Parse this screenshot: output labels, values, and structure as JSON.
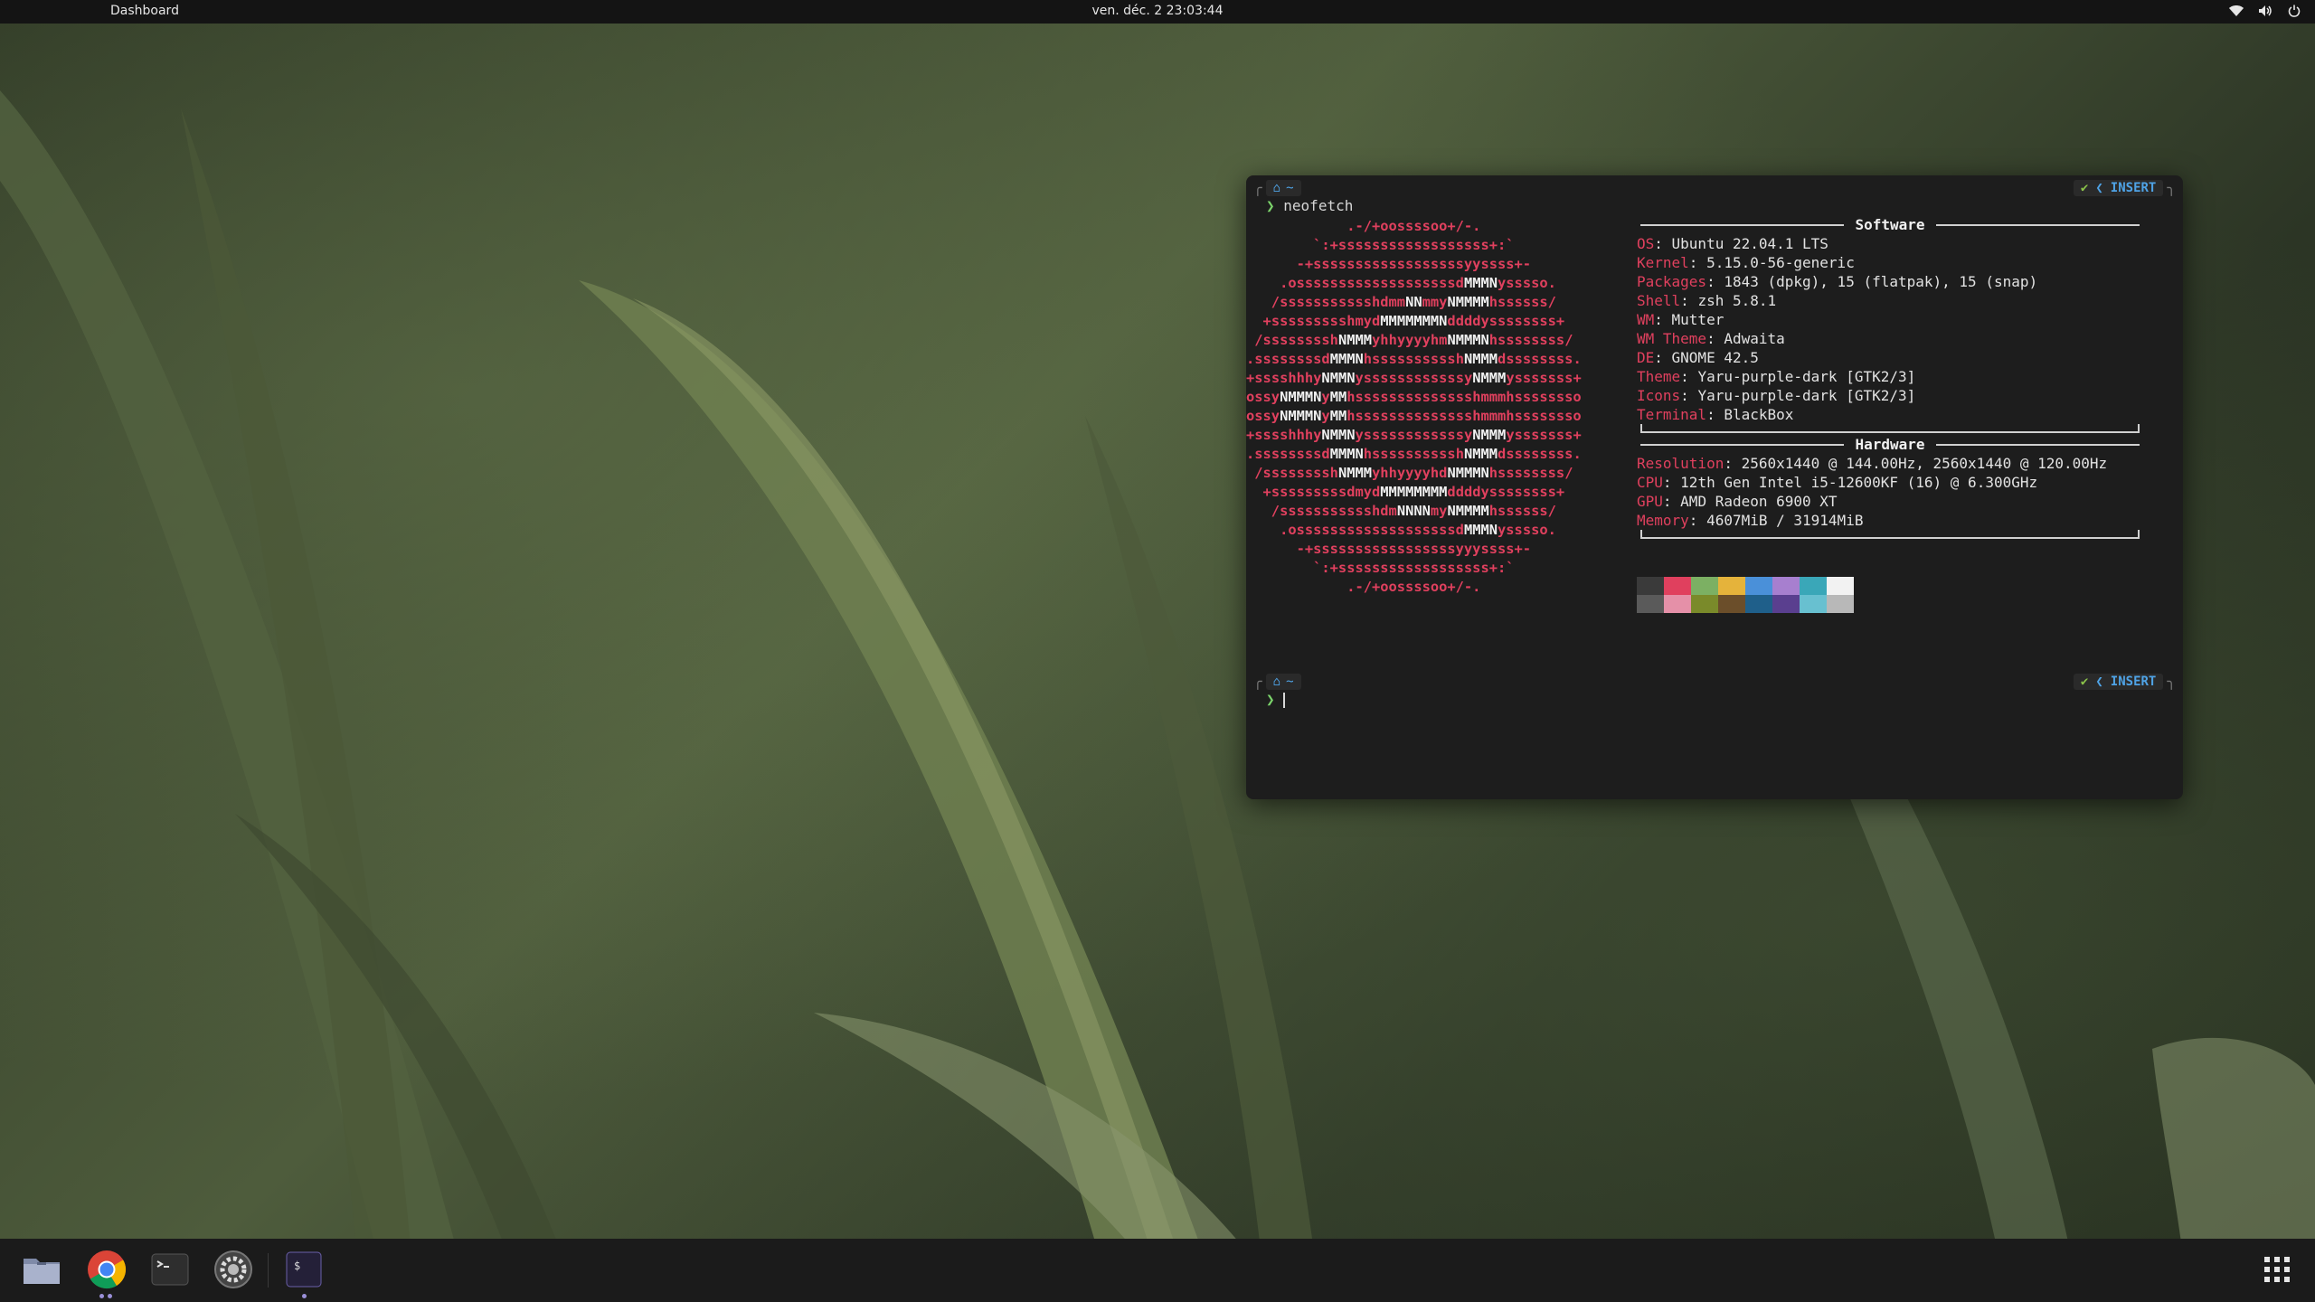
{
  "topbar": {
    "activities": "Dashboard",
    "clock": "ven. déc. 2  23:03:44"
  },
  "terminal": {
    "prompt_home_icon": "home-icon",
    "prompt_dir": "~",
    "mode": "INSERT",
    "command": "neofetch",
    "ascii_lines": [
      "            .-/+oossssoo+/-.",
      "        `:+ssssssssssssssssss+:`",
      "      -+ssssssssssssssssssyyssss+-",
      "    .osssssssssssssssssssdMMMNysssso.",
      "   /ssssssssssshdmmNNmmyNMMMMhssssss/",
      "  +ssssssssshmydMMMMMMMNddddyssssssss+",
      " /sssssssshNMMMyhhyyyyhmNMMMNhssssssss/",
      ".ssssssssdMMMNhsssssssssshNMMMdssssssss.",
      "+sssshhhyNMMNyssssssssssssyNMMMysssssss+",
      "ossyNMMMNyMMhsssssssssssssshmmmhssssssso",
      "ossyNMMMNyMMhsssssssssssssshmmmhssssssso",
      "+sssshhhyNMMNyssssssssssssyNMMMysssssss+",
      ".ssssssssdMMMNhsssssssssshNMMMdssssssss.",
      " /sssssssshNMMMyhhyyyyhdNMMMNhssssssss/",
      "  +sssssssssdmydMMMMMMMMddddyssssssss+",
      "   /ssssssssssshdmNNNNmyNMMMMhssssss/",
      "    .osssssssssssssssssssdMMMNysssso.",
      "      -+sssssssssssssssssyyyssss+-",
      "        `:+ssssssssssssssssss+:`",
      "            .-/+oossssoo+/-."
    ],
    "software": {
      "title": "Software",
      "rows": [
        {
          "key": "OS",
          "value": "Ubuntu 22.04.1 LTS"
        },
        {
          "key": "Kernel",
          "value": "5.15.0-56-generic"
        },
        {
          "key": "Packages",
          "value": "1843 (dpkg), 15 (flatpak), 15 (snap)"
        },
        {
          "key": "Shell",
          "value": "zsh 5.8.1"
        },
        {
          "key": "WM",
          "value": "Mutter"
        },
        {
          "key": "WM Theme",
          "value": "Adwaita"
        },
        {
          "key": "DE",
          "value": "GNOME 42.5"
        },
        {
          "key": "Theme",
          "value": "Yaru-purple-dark [GTK2/3]"
        },
        {
          "key": "Icons",
          "value": "Yaru-purple-dark [GTK2/3]"
        },
        {
          "key": "Terminal",
          "value": "BlackBox"
        }
      ]
    },
    "hardware": {
      "title": "Hardware",
      "rows": [
        {
          "key": "Resolution",
          "value": "2560x1440 @ 144.00Hz, 2560x1440 @ 120.00Hz"
        },
        {
          "key": "CPU",
          "value": "12th Gen Intel i5-12600KF (16) @ 6.300GHz"
        },
        {
          "key": "GPU",
          "value": "AMD Radeon 6900 XT"
        },
        {
          "key": "Memory",
          "value": "4607MiB / 31914MiB"
        }
      ]
    },
    "palette_top": [
      "#3a3a3a",
      "#e0405e",
      "#7cb063",
      "#e5b33b",
      "#4a90d9",
      "#a77fcf",
      "#3aa7b8",
      "#f2f2f2"
    ],
    "palette_bottom": [
      "#5a5a5a",
      "#e590a8",
      "#7a8a2a",
      "#6b4e2a",
      "#1f5f8a",
      "#5a3f8f",
      "#68c0d0",
      "#b8b8b8"
    ]
  },
  "dock": {
    "items": [
      {
        "name": "files-app",
        "icon": "folder-icon"
      },
      {
        "name": "chrome-app",
        "icon": "chrome-icon"
      },
      {
        "name": "terminal-app",
        "icon": "terminal-icon"
      },
      {
        "name": "settings-app",
        "icon": "gear-icon"
      },
      {
        "name": "blackbox-app",
        "icon": "blackbox-terminal-icon"
      }
    ],
    "grid_icon": "app-grid-icon"
  }
}
